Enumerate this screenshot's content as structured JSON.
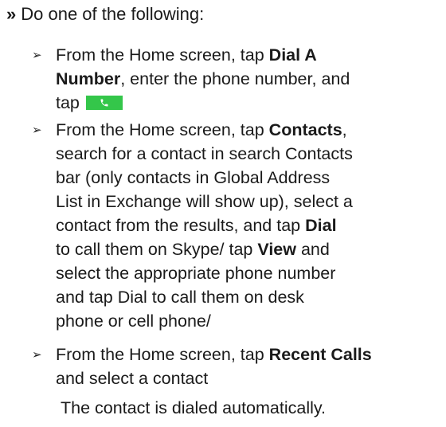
{
  "lead": {
    "marker": "»",
    "text": "Do one of the following:"
  },
  "bullet_glyph": "➢",
  "items": [
    {
      "l1_a": "From the Home screen, tap ",
      "l1_b": "Dial A",
      "l2_a": "Number",
      "l2_b": ",  enter the phone number, and",
      "l3_a": "tap "
    },
    {
      "l1_a": "From the Home screen, tap ",
      "l1_b": "Contacts",
      "l1_c": ",",
      "l2": "search for a contact in search Contacts",
      "l3": "bar (only contacts in Global Address",
      "l4": "List in Exchange will show up), select a",
      "l5_a": "contact from the results, and  tap ",
      "l5_b": "Dial",
      "l6_a": "to call them on Skype/ tap ",
      "l6_b": "View",
      "l6_c": " and",
      "l7": "select the appropriate phone number",
      "l8": "and tap Dial to call them on desk",
      "l9": "phone or cell phone/"
    },
    {
      "l1_a": "From the Home screen, tap ",
      "l1_b": "Recent Calls",
      "l2": "and select a contact"
    }
  ],
  "result": "The contact is dialed automatically.",
  "colors": {
    "dial_button": "#34c64a",
    "icon": "#ffffff"
  },
  "icons": {
    "dial": "phone-handset-icon"
  }
}
